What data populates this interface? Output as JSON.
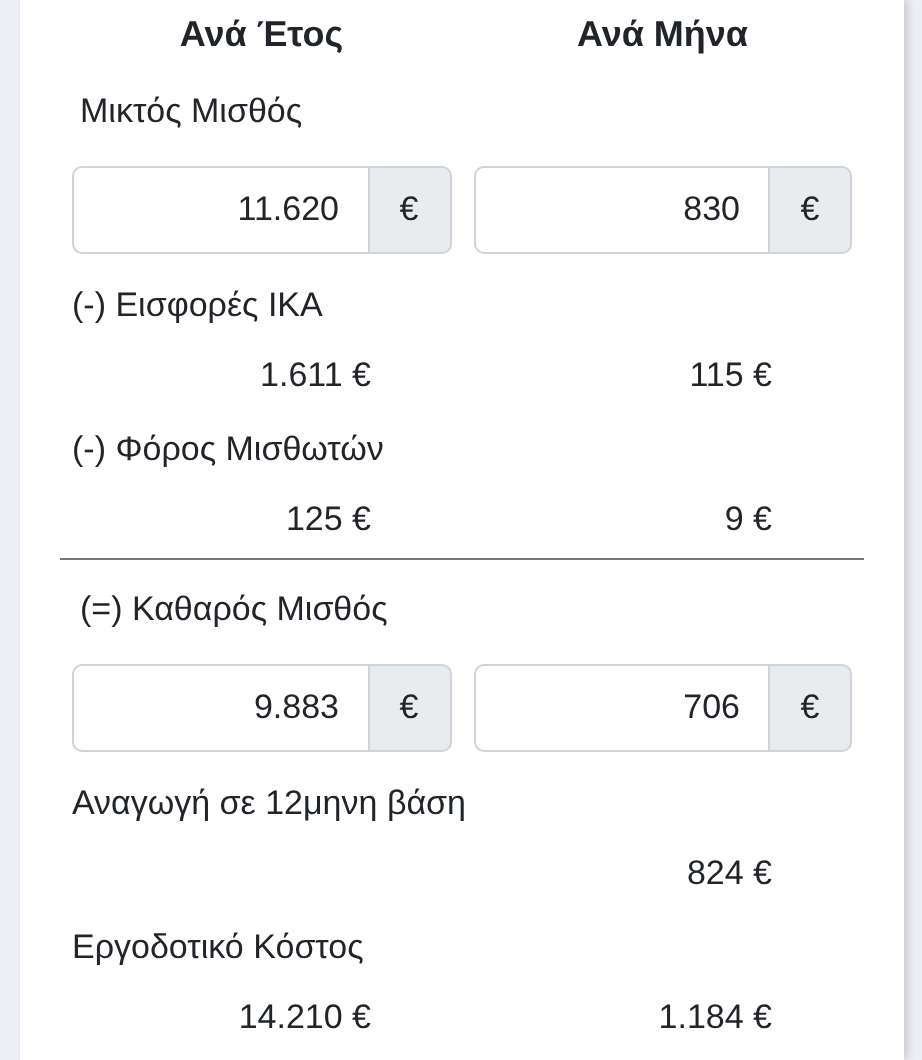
{
  "headers": [
    "Ανά Έτος",
    "Ανά Μήνα"
  ],
  "sections": [
    {
      "kind": "input",
      "label": "Μικτός Μισθός",
      "values": [
        {
          "value": "11.620",
          "unit": "€"
        },
        {
          "value": "830",
          "unit": "€"
        }
      ]
    },
    {
      "kind": "values",
      "label": "(-) Εισφορές ΙΚΑ",
      "year": "1.611 €",
      "month": "115 €"
    },
    {
      "kind": "values",
      "label": "(-) Φόρος Μισθωτών",
      "year": "125 €",
      "month": "9 €"
    },
    {
      "kind": "divider"
    },
    {
      "kind": "input",
      "label": "(=) Καθαρός Μισθός",
      "values": [
        {
          "value": "9.883",
          "unit": "€"
        },
        {
          "value": "706",
          "unit": "€"
        }
      ]
    },
    {
      "kind": "values",
      "label": "Αναγωγή σε 12μηνη βάση",
      "month": "824 €"
    },
    {
      "kind": "values",
      "label": "Εργοδοτικό Κόστος",
      "year": "14.210 €",
      "month": "1.184 €"
    }
  ]
}
